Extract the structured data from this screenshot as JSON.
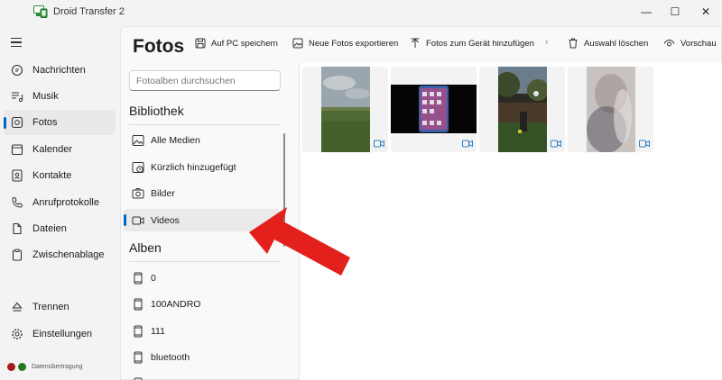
{
  "app": {
    "title": "Droid Transfer 2",
    "window_controls": {
      "minimize": "—",
      "maximize": "☐",
      "close": "✕"
    }
  },
  "nav": {
    "items": [
      {
        "label": "Nachrichten",
        "icon": "chat-icon"
      },
      {
        "label": "Musik",
        "icon": "music-list-icon"
      },
      {
        "label": "Fotos",
        "icon": "photo-icon",
        "active": true
      },
      {
        "label": "Kalender",
        "icon": "calendar-icon"
      },
      {
        "label": "Kontakte",
        "icon": "contacts-icon"
      },
      {
        "label": "Anrufprotokolle",
        "icon": "phone-icon"
      },
      {
        "label": "Dateien",
        "icon": "file-icon"
      },
      {
        "label": "Zwischenablage",
        "icon": "clipboard-icon"
      }
    ],
    "bottom_items": [
      {
        "label": "Trennen",
        "icon": "eject-icon"
      },
      {
        "label": "Einstellungen",
        "icon": "gear-icon"
      }
    ],
    "status": {
      "text": "Datenübertragung",
      "colors": [
        "#a31b1b",
        "#1e7a1e"
      ]
    }
  },
  "page": {
    "title": "Fotos"
  },
  "toolbar": {
    "save_to_pc": "Auf PC speichern",
    "export_new": "Neue Fotos exportieren",
    "add_to_device": "Fotos zum Gerät hinzufügen",
    "delete_selection": "Auswahl löschen",
    "preview": "Vorschau",
    "separator": "›"
  },
  "albums": {
    "search_placeholder": "Fotoalben durchsuchen",
    "library_heading": "Bibliothek",
    "library": [
      {
        "label": "Alle Medien",
        "icon": "image-icon"
      },
      {
        "label": "Kürzlich hinzugefügt",
        "icon": "recent-icon"
      },
      {
        "label": "Bilder",
        "icon": "camera-icon"
      },
      {
        "label": "Videos",
        "icon": "video-icon",
        "active": true
      }
    ],
    "albums_heading": "Alben",
    "albums": [
      {
        "label": "0",
        "icon": "phone-album-icon"
      },
      {
        "label": "100ANDRO",
        "icon": "phone-album-icon"
      },
      {
        "label": "111",
        "icon": "phone-album-icon"
      },
      {
        "label": "bluetooth",
        "icon": "phone-album-icon"
      }
    ]
  },
  "media": [
    {
      "type": "video",
      "name": "field-landscape-video"
    },
    {
      "type": "video",
      "name": "phone-screen-video"
    },
    {
      "type": "video",
      "name": "garden-night-video"
    },
    {
      "type": "video",
      "name": "blurred-portrait-video"
    }
  ],
  "colors": {
    "accent": "#0067c0",
    "arrow": "#e3201b",
    "video_icon": "#2f7fc1"
  }
}
